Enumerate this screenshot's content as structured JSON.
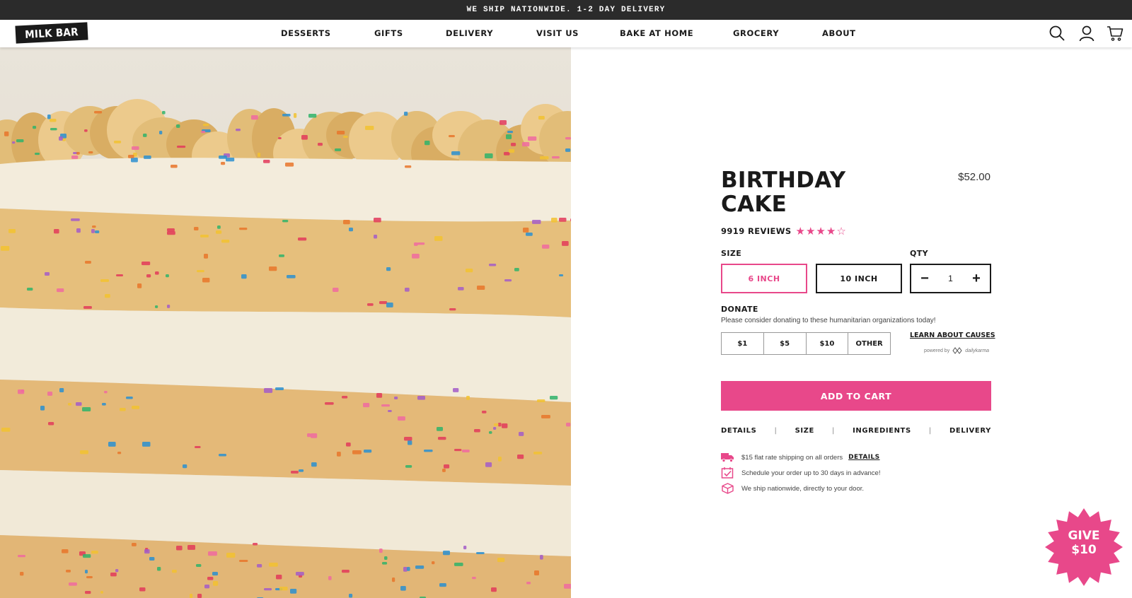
{
  "announcement": "WE SHIP NATIONWIDE. 1-2 DAY DELIVERY",
  "logo_text": "MILK BAR",
  "nav": {
    "items": [
      "DESSERTS",
      "GIFTS",
      "DELIVERY",
      "VISIT US",
      "BAKE AT HOME",
      "GROCERY",
      "ABOUT"
    ]
  },
  "header_icons": [
    "search-icon",
    "account-icon",
    "cart-icon"
  ],
  "product": {
    "title_line1": "BIRTHDAY",
    "title_line2": "CAKE",
    "price": "$52.00",
    "reviews": "9919 REVIEWS",
    "rating": 4,
    "rating_max": 5
  },
  "size": {
    "label": "SIZE",
    "options": [
      "6 INCH",
      "10 INCH"
    ],
    "selected": "6 INCH"
  },
  "qty": {
    "label": "QTY",
    "minus": "−",
    "value": "1",
    "plus": "+"
  },
  "donate": {
    "label": "DONATE",
    "text": "Please consider donating to these humanitarian organizations today!",
    "options": [
      "$1",
      "$5",
      "$10",
      "OTHER"
    ],
    "learn_link": "LEARN ABOUT CAUSES",
    "powered_by": "powered by",
    "powered_brand": "dailykarma"
  },
  "add_to_cart": "ADD TO CART",
  "tabs": [
    "DETAILS",
    "SIZE",
    "INGREDIENTS",
    "DELIVERY"
  ],
  "tab_separator": "|",
  "features": [
    {
      "icon": "truck-icon",
      "text": "$15 flat rate shipping on all orders",
      "link": "DETAILS"
    },
    {
      "icon": "calendar-check-icon",
      "text": "Schedule your order up to 30 days in advance!"
    },
    {
      "icon": "box-icon",
      "text": "We ship nationwide, directly to your door."
    }
  ],
  "give_badge": {
    "line1": "GIVE",
    "line2": "$10"
  },
  "colors": {
    "accent": "#e8488a",
    "dark": "#1a1a1a",
    "announce_bg": "#2b2b2b"
  }
}
